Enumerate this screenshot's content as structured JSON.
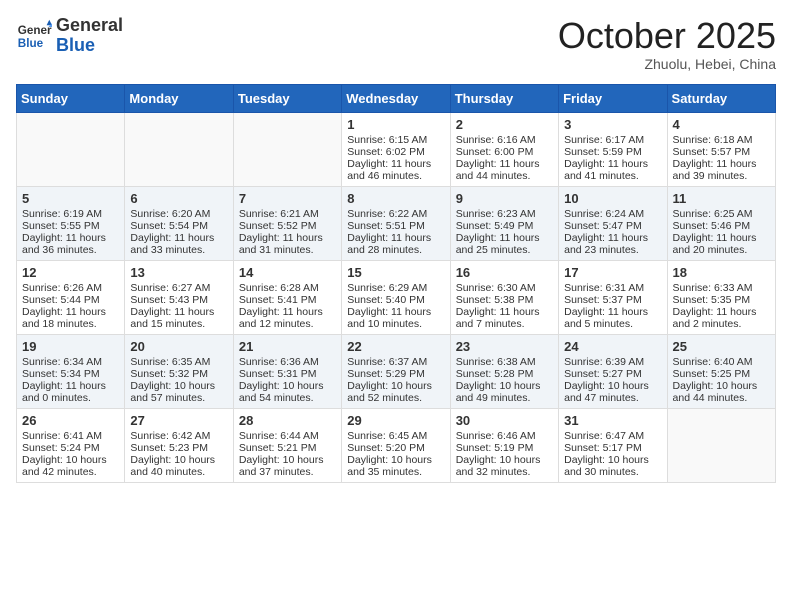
{
  "header": {
    "logo_line1": "General",
    "logo_line2": "Blue",
    "month": "October 2025",
    "location": "Zhuolu, Hebei, China"
  },
  "weekdays": [
    "Sunday",
    "Monday",
    "Tuesday",
    "Wednesday",
    "Thursday",
    "Friday",
    "Saturday"
  ],
  "weeks": [
    [
      {
        "day": "",
        "sunrise": "",
        "sunset": "",
        "daylight": ""
      },
      {
        "day": "",
        "sunrise": "",
        "sunset": "",
        "daylight": ""
      },
      {
        "day": "",
        "sunrise": "",
        "sunset": "",
        "daylight": ""
      },
      {
        "day": "1",
        "sunrise": "Sunrise: 6:15 AM",
        "sunset": "Sunset: 6:02 PM",
        "daylight": "Daylight: 11 hours and 46 minutes."
      },
      {
        "day": "2",
        "sunrise": "Sunrise: 6:16 AM",
        "sunset": "Sunset: 6:00 PM",
        "daylight": "Daylight: 11 hours and 44 minutes."
      },
      {
        "day": "3",
        "sunrise": "Sunrise: 6:17 AM",
        "sunset": "Sunset: 5:59 PM",
        "daylight": "Daylight: 11 hours and 41 minutes."
      },
      {
        "day": "4",
        "sunrise": "Sunrise: 6:18 AM",
        "sunset": "Sunset: 5:57 PM",
        "daylight": "Daylight: 11 hours and 39 minutes."
      }
    ],
    [
      {
        "day": "5",
        "sunrise": "Sunrise: 6:19 AM",
        "sunset": "Sunset: 5:55 PM",
        "daylight": "Daylight: 11 hours and 36 minutes."
      },
      {
        "day": "6",
        "sunrise": "Sunrise: 6:20 AM",
        "sunset": "Sunset: 5:54 PM",
        "daylight": "Daylight: 11 hours and 33 minutes."
      },
      {
        "day": "7",
        "sunrise": "Sunrise: 6:21 AM",
        "sunset": "Sunset: 5:52 PM",
        "daylight": "Daylight: 11 hours and 31 minutes."
      },
      {
        "day": "8",
        "sunrise": "Sunrise: 6:22 AM",
        "sunset": "Sunset: 5:51 PM",
        "daylight": "Daylight: 11 hours and 28 minutes."
      },
      {
        "day": "9",
        "sunrise": "Sunrise: 6:23 AM",
        "sunset": "Sunset: 5:49 PM",
        "daylight": "Daylight: 11 hours and 25 minutes."
      },
      {
        "day": "10",
        "sunrise": "Sunrise: 6:24 AM",
        "sunset": "Sunset: 5:47 PM",
        "daylight": "Daylight: 11 hours and 23 minutes."
      },
      {
        "day": "11",
        "sunrise": "Sunrise: 6:25 AM",
        "sunset": "Sunset: 5:46 PM",
        "daylight": "Daylight: 11 hours and 20 minutes."
      }
    ],
    [
      {
        "day": "12",
        "sunrise": "Sunrise: 6:26 AM",
        "sunset": "Sunset: 5:44 PM",
        "daylight": "Daylight: 11 hours and 18 minutes."
      },
      {
        "day": "13",
        "sunrise": "Sunrise: 6:27 AM",
        "sunset": "Sunset: 5:43 PM",
        "daylight": "Daylight: 11 hours and 15 minutes."
      },
      {
        "day": "14",
        "sunrise": "Sunrise: 6:28 AM",
        "sunset": "Sunset: 5:41 PM",
        "daylight": "Daylight: 11 hours and 12 minutes."
      },
      {
        "day": "15",
        "sunrise": "Sunrise: 6:29 AM",
        "sunset": "Sunset: 5:40 PM",
        "daylight": "Daylight: 11 hours and 10 minutes."
      },
      {
        "day": "16",
        "sunrise": "Sunrise: 6:30 AM",
        "sunset": "Sunset: 5:38 PM",
        "daylight": "Daylight: 11 hours and 7 minutes."
      },
      {
        "day": "17",
        "sunrise": "Sunrise: 6:31 AM",
        "sunset": "Sunset: 5:37 PM",
        "daylight": "Daylight: 11 hours and 5 minutes."
      },
      {
        "day": "18",
        "sunrise": "Sunrise: 6:33 AM",
        "sunset": "Sunset: 5:35 PM",
        "daylight": "Daylight: 11 hours and 2 minutes."
      }
    ],
    [
      {
        "day": "19",
        "sunrise": "Sunrise: 6:34 AM",
        "sunset": "Sunset: 5:34 PM",
        "daylight": "Daylight: 11 hours and 0 minutes."
      },
      {
        "day": "20",
        "sunrise": "Sunrise: 6:35 AM",
        "sunset": "Sunset: 5:32 PM",
        "daylight": "Daylight: 10 hours and 57 minutes."
      },
      {
        "day": "21",
        "sunrise": "Sunrise: 6:36 AM",
        "sunset": "Sunset: 5:31 PM",
        "daylight": "Daylight: 10 hours and 54 minutes."
      },
      {
        "day": "22",
        "sunrise": "Sunrise: 6:37 AM",
        "sunset": "Sunset: 5:29 PM",
        "daylight": "Daylight: 10 hours and 52 minutes."
      },
      {
        "day": "23",
        "sunrise": "Sunrise: 6:38 AM",
        "sunset": "Sunset: 5:28 PM",
        "daylight": "Daylight: 10 hours and 49 minutes."
      },
      {
        "day": "24",
        "sunrise": "Sunrise: 6:39 AM",
        "sunset": "Sunset: 5:27 PM",
        "daylight": "Daylight: 10 hours and 47 minutes."
      },
      {
        "day": "25",
        "sunrise": "Sunrise: 6:40 AM",
        "sunset": "Sunset: 5:25 PM",
        "daylight": "Daylight: 10 hours and 44 minutes."
      }
    ],
    [
      {
        "day": "26",
        "sunrise": "Sunrise: 6:41 AM",
        "sunset": "Sunset: 5:24 PM",
        "daylight": "Daylight: 10 hours and 42 minutes."
      },
      {
        "day": "27",
        "sunrise": "Sunrise: 6:42 AM",
        "sunset": "Sunset: 5:23 PM",
        "daylight": "Daylight: 10 hours and 40 minutes."
      },
      {
        "day": "28",
        "sunrise": "Sunrise: 6:44 AM",
        "sunset": "Sunset: 5:21 PM",
        "daylight": "Daylight: 10 hours and 37 minutes."
      },
      {
        "day": "29",
        "sunrise": "Sunrise: 6:45 AM",
        "sunset": "Sunset: 5:20 PM",
        "daylight": "Daylight: 10 hours and 35 minutes."
      },
      {
        "day": "30",
        "sunrise": "Sunrise: 6:46 AM",
        "sunset": "Sunset: 5:19 PM",
        "daylight": "Daylight: 10 hours and 32 minutes."
      },
      {
        "day": "31",
        "sunrise": "Sunrise: 6:47 AM",
        "sunset": "Sunset: 5:17 PM",
        "daylight": "Daylight: 10 hours and 30 minutes."
      },
      {
        "day": "",
        "sunrise": "",
        "sunset": "",
        "daylight": ""
      }
    ]
  ]
}
